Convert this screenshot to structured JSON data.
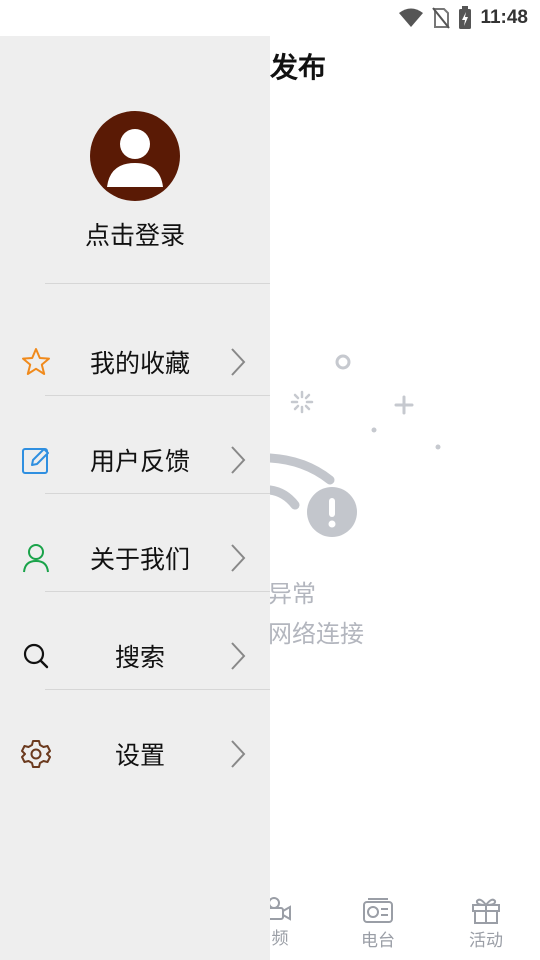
{
  "status_bar": {
    "time": "11:48",
    "icons": [
      "wifi-icon",
      "no-sim-icon",
      "battery-charging-icon"
    ]
  },
  "background_page": {
    "title": "发布",
    "error_text": "异常",
    "hint_text": "网络连接",
    "tabs": [
      {
        "label": "频",
        "icon": "video-icon"
      },
      {
        "label": "电台",
        "icon": "radio-icon"
      },
      {
        "label": "活动",
        "icon": "gift-icon"
      }
    ]
  },
  "drawer": {
    "login_text": "点击登录",
    "avatar_icon": "user-avatar-icon",
    "menu": [
      {
        "label": "我的收藏",
        "icon": "star-icon",
        "icon_color": "#f08a1c"
      },
      {
        "label": "用户反馈",
        "icon": "edit-icon",
        "icon_color": "#2f8fe0"
      },
      {
        "label": "关于我们",
        "icon": "person-icon",
        "icon_color": "#1aa34a"
      },
      {
        "label": "搜索",
        "icon": "search-icon",
        "icon_color": "#111111"
      },
      {
        "label": "设置",
        "icon": "gear-icon",
        "icon_color": "#6b3a1e"
      }
    ]
  },
  "colors": {
    "drawer_bg": "#eeeeee",
    "avatar_bg": "#5a1a05",
    "muted_text": "#b3b6be"
  }
}
